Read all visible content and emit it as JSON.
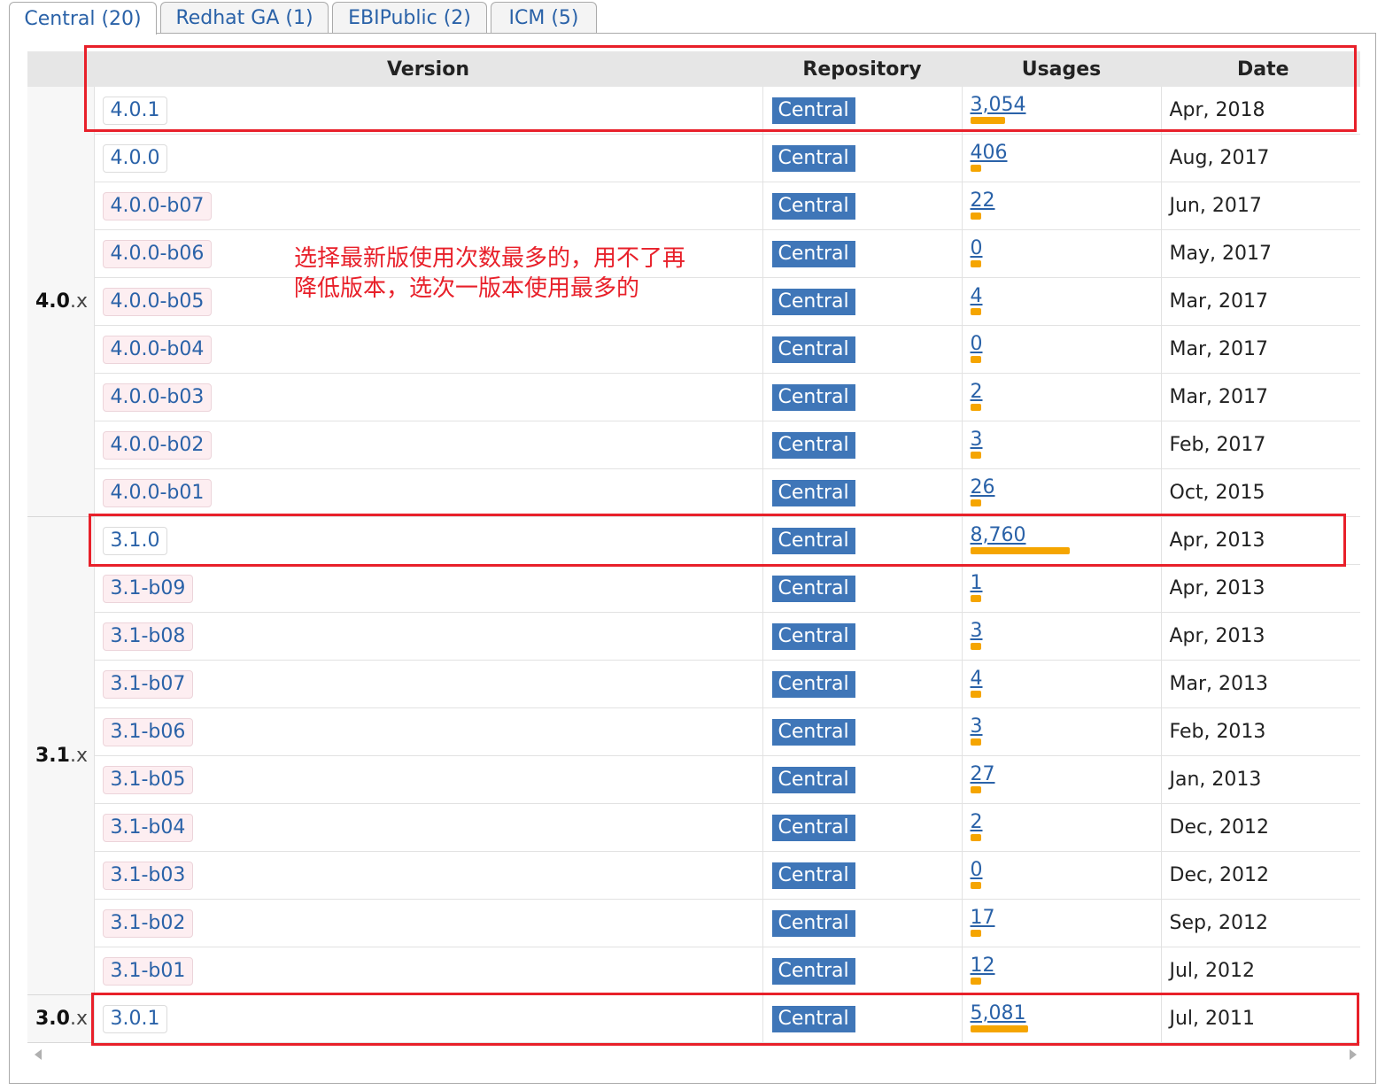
{
  "tabs": [
    {
      "label": "Central (20)"
    },
    {
      "label": "Redhat GA (1)"
    },
    {
      "label": "EBIPublic (2)"
    },
    {
      "label": "ICM (5)"
    }
  ],
  "table": {
    "headers": {
      "version": "Version",
      "repository": "Repository",
      "usages": "Usages",
      "date": "Date"
    },
    "groups": [
      {
        "major": "4.0",
        "suffix": ".x"
      },
      {
        "major": "3.1",
        "suffix": ".x"
      },
      {
        "major": "3.0",
        "suffix": ".x"
      }
    ],
    "rows": [
      {
        "version": "4.0.1",
        "repo": "Central",
        "usages": "3,054",
        "usage_count": 3054,
        "date": "Apr, 2018"
      },
      {
        "version": "4.0.0",
        "repo": "Central",
        "usages": "406",
        "usage_count": 406,
        "date": "Aug, 2017"
      },
      {
        "version": "4.0.0-b07",
        "repo": "Central",
        "usages": "22",
        "usage_count": 22,
        "date": "Jun, 2017"
      },
      {
        "version": "4.0.0-b06",
        "repo": "Central",
        "usages": "0",
        "usage_count": 0,
        "date": "May, 2017"
      },
      {
        "version": "4.0.0-b05",
        "repo": "Central",
        "usages": "4",
        "usage_count": 4,
        "date": "Mar, 2017"
      },
      {
        "version": "4.0.0-b04",
        "repo": "Central",
        "usages": "0",
        "usage_count": 0,
        "date": "Mar, 2017"
      },
      {
        "version": "4.0.0-b03",
        "repo": "Central",
        "usages": "2",
        "usage_count": 2,
        "date": "Mar, 2017"
      },
      {
        "version": "4.0.0-b02",
        "repo": "Central",
        "usages": "3",
        "usage_count": 3,
        "date": "Feb, 2017"
      },
      {
        "version": "4.0.0-b01",
        "repo": "Central",
        "usages": "26",
        "usage_count": 26,
        "date": "Oct, 2015"
      },
      {
        "version": "3.1.0",
        "repo": "Central",
        "usages": "8,760",
        "usage_count": 8760,
        "date": "Apr, 2013"
      },
      {
        "version": "3.1-b09",
        "repo": "Central",
        "usages": "1",
        "usage_count": 1,
        "date": "Apr, 2013"
      },
      {
        "version": "3.1-b08",
        "repo": "Central",
        "usages": "3",
        "usage_count": 3,
        "date": "Apr, 2013"
      },
      {
        "version": "3.1-b07",
        "repo": "Central",
        "usages": "4",
        "usage_count": 4,
        "date": "Mar, 2013"
      },
      {
        "version": "3.1-b06",
        "repo": "Central",
        "usages": "3",
        "usage_count": 3,
        "date": "Feb, 2013"
      },
      {
        "version": "3.1-b05",
        "repo": "Central",
        "usages": "27",
        "usage_count": 27,
        "date": "Jan, 2013"
      },
      {
        "version": "3.1-b04",
        "repo": "Central",
        "usages": "2",
        "usage_count": 2,
        "date": "Dec, 2012"
      },
      {
        "version": "3.1-b03",
        "repo": "Central",
        "usages": "0",
        "usage_count": 0,
        "date": "Dec, 2012"
      },
      {
        "version": "3.1-b02",
        "repo": "Central",
        "usages": "17",
        "usage_count": 17,
        "date": "Sep, 2012"
      },
      {
        "version": "3.1-b01",
        "repo": "Central",
        "usages": "12",
        "usage_count": 12,
        "date": "Jul, 2012"
      },
      {
        "version": "3.0.1",
        "repo": "Central",
        "usages": "5,081",
        "usage_count": 5081,
        "date": "Jul, 2011"
      }
    ]
  },
  "annotation": {
    "line1": "选择最新版使用次数最多的，用不了再",
    "line2": "降低版本，选次一版本使用最多的"
  },
  "colors": {
    "link": "#2a62a8",
    "repo_badge": "#3f76b8",
    "usage_bar": "#f5a500",
    "highlight": "#e8202a",
    "beta_tag": "#fdeef1"
  },
  "icons": {
    "scroll_left": "chevron-left-icon",
    "scroll_right": "chevron-right-icon"
  }
}
